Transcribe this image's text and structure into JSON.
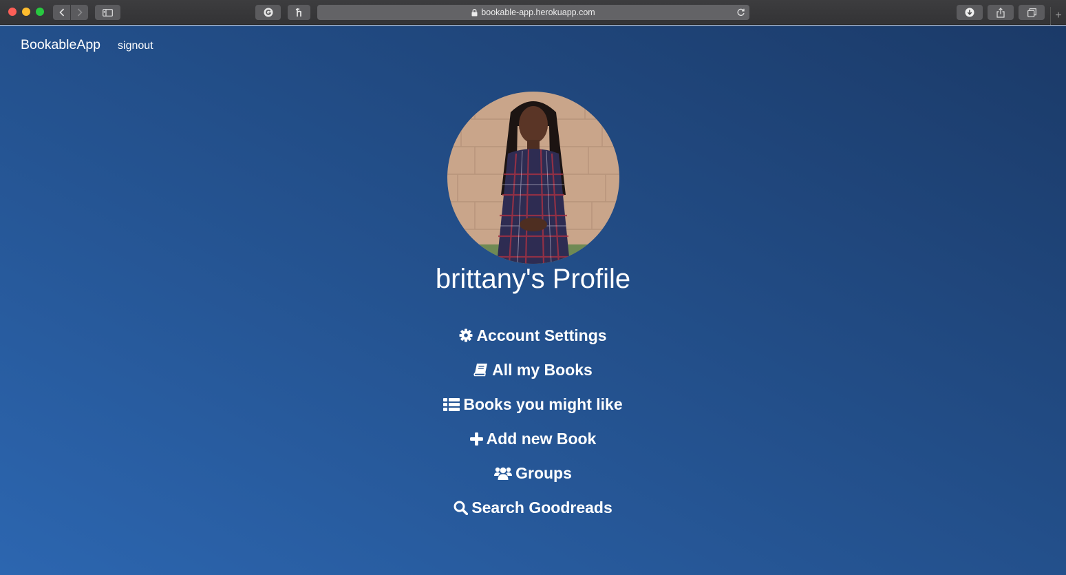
{
  "browser": {
    "url": "bookable-app.herokuapp.com",
    "newtab_symbol": "+"
  },
  "nav": {
    "brand": "BookableApp",
    "signout": "signout"
  },
  "profile": {
    "title": "brittany's Profile"
  },
  "menu": [
    {
      "icon": "gear-icon",
      "label": "Account Settings"
    },
    {
      "icon": "book-icon",
      "label": "All my Books"
    },
    {
      "icon": "list-icon",
      "label": "Books you might like"
    },
    {
      "icon": "plus-icon",
      "label": "Add new Book"
    },
    {
      "icon": "users-icon",
      "label": "Groups"
    },
    {
      "icon": "search-icon",
      "label": "Search Goodreads"
    }
  ],
  "colors": {
    "page_gradient_start": "#2c66b0",
    "page_gradient_end": "#1b3a68",
    "text": "#ffffff"
  }
}
